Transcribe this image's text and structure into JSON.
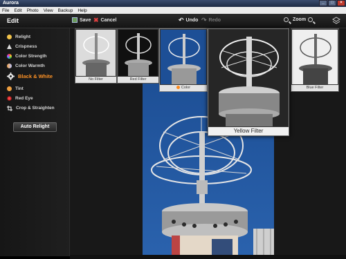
{
  "app": {
    "title": "Aurora"
  },
  "menu": [
    "File",
    "Edit",
    "Photo",
    "View",
    "Backup",
    "Help"
  ],
  "toolbar": {
    "section": "Edit",
    "save": "Save",
    "cancel": "Cancel",
    "undo": "Undo",
    "redo": "Redo",
    "zoom": "Zoom"
  },
  "sidebar": {
    "items": [
      {
        "label": "Relight",
        "icon": "sun-icon",
        "color": "#f2c34a"
      },
      {
        "label": "Crispness",
        "icon": "triangle-icon",
        "color": "#d8d8d8"
      },
      {
        "label": "Color Strength",
        "icon": "color-wheel-icon",
        "color": "#7fb3e6"
      },
      {
        "label": "Color Warmth",
        "icon": "warmth-icon",
        "color": "#b9c6ff"
      },
      {
        "label": "Black & White",
        "icon": "gear-icon",
        "color": "#ff9326"
      },
      {
        "label": "Tint",
        "icon": "tint-icon",
        "color": "#f0a040"
      },
      {
        "label": "Red Eye",
        "icon": "eye-icon",
        "color": "#d94a4a"
      },
      {
        "label": "Crop & Straighten",
        "icon": "crop-icon",
        "color": "#d8d8d8"
      }
    ],
    "auto_button": "Auto Relight"
  },
  "filters": [
    {
      "label": "No Filter",
      "tone": "#b8b8b8",
      "bg": "#dcdcdc"
    },
    {
      "label": "Red Filter",
      "tone": "#c8c8c8",
      "bg": "#101010"
    },
    {
      "label": "Color",
      "tone": "#d8d8d8",
      "bg": "#1d4f96"
    },
    {
      "label": "Yellow Filter",
      "tone": "#e8e8e8",
      "bg": "#262626"
    },
    {
      "label": "Blue Filter",
      "tone": "#b0b0b0",
      "bg": "#efefef"
    }
  ]
}
